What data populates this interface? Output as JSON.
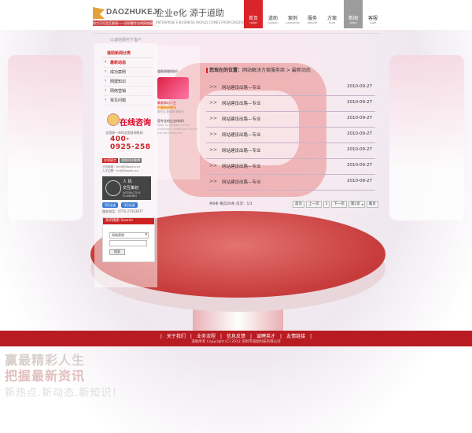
{
  "header": {
    "brand": "DAOZHUKEJI",
    "tagline": "努力于打造互联网——深圳最专业的网络服务平台",
    "slogan": "企业e化 源于道助",
    "slogan_en": "ENTERPRISE E-BUSINESS WORLD COMES FROM DAOZHU",
    "nav": [
      {
        "zh": "首页",
        "en": "HOME",
        "state": "active"
      },
      {
        "zh": "道助",
        "en": "DAOZHU",
        "state": "normal"
      },
      {
        "zh": "案例",
        "en": "CASESHOW",
        "state": "normal"
      },
      {
        "zh": "服务",
        "en": "SERVICE",
        "state": "normal"
      },
      {
        "zh": "方案",
        "en": "PLAN",
        "state": "normal"
      },
      {
        "zh": "新闻",
        "en": "NEWS",
        "state": "grey"
      },
      {
        "zh": "客服",
        "en": "CARE",
        "state": "normal"
      }
    ]
  },
  "top_path": "以诚信服务于客户",
  "sidebar": {
    "title": "道助新闻分类",
    "items": [
      "最新动态",
      "成功案例",
      "网建知识",
      "网络营销",
      "常见问题"
    ],
    "active_index": 0,
    "consult_label": "在线咨询",
    "hotline_label": "全国统一400全国咨询热线",
    "hotline": "400-0925-258",
    "btn1": "在线留言",
    "btn2": "道助科技微博",
    "emails": [
      "业务邮箱：bmd@daozhu.cn",
      "人才招聘：hrd@daozhu.cn"
    ],
    "interactive_t1": "人    机",
    "interactive_t2": "交互策划",
    "interactive_t3": "INTERACTIVE PLANNING",
    "qq1": "QQ洽谈",
    "qq2": "QQ洽谈",
    "tel": "服务电话：0755-27503877",
    "search_title": "资讯搜索 Search",
    "search_select": "网络营销",
    "search_btn": "搜索"
  },
  "promo": {
    "title": "道助网络科技》",
    "slogan1": "赢最精彩人生",
    "slogan2": "把握最新资讯",
    "small": "新热点·新动态·新知识",
    "sub": "您专业的企业伙伴》",
    "desc": "Keep us updated on our customers' needs and deliver the right solutions"
  },
  "breadcrumb": {
    "label": "您现在的位置：",
    "path": "网站解决方案服务商 > 最新动态"
  },
  "news": [
    {
      "title": "网站建设出路—专业",
      "date": "2010-09-27"
    },
    {
      "title": "网站建设出路—专业",
      "date": "2010-09-27"
    },
    {
      "title": "网站建设出路—专业",
      "date": "2010-09-27"
    },
    {
      "title": "网站建设出路—专业",
      "date": "2010-09-27"
    },
    {
      "title": "网站建设出路—专业",
      "date": "2010-09-27"
    },
    {
      "title": "网站建设出路—专业",
      "date": "2010-09-27"
    },
    {
      "title": "网站建设出路—专业",
      "date": "2010-09-27"
    }
  ],
  "pager": {
    "info": "共0条 每页20条 页次：1/1",
    "first": "首页",
    "prev": "上一页",
    "page_input": "1",
    "next": "下一页",
    "select": "第1页",
    "last": "尾页"
  },
  "footer": {
    "links": [
      "关于我们",
      "业务流程",
      "信息反馈",
      "诚聘英才",
      "友情链接"
    ],
    "copyright": "道助所有  Copyright (C) 2012  深圳市道助科技有限公司"
  },
  "decor": {
    "line1": "赢最精彩人生",
    "line2": "把握最新资讯",
    "line3": "新热点.新动态.新知识！"
  }
}
